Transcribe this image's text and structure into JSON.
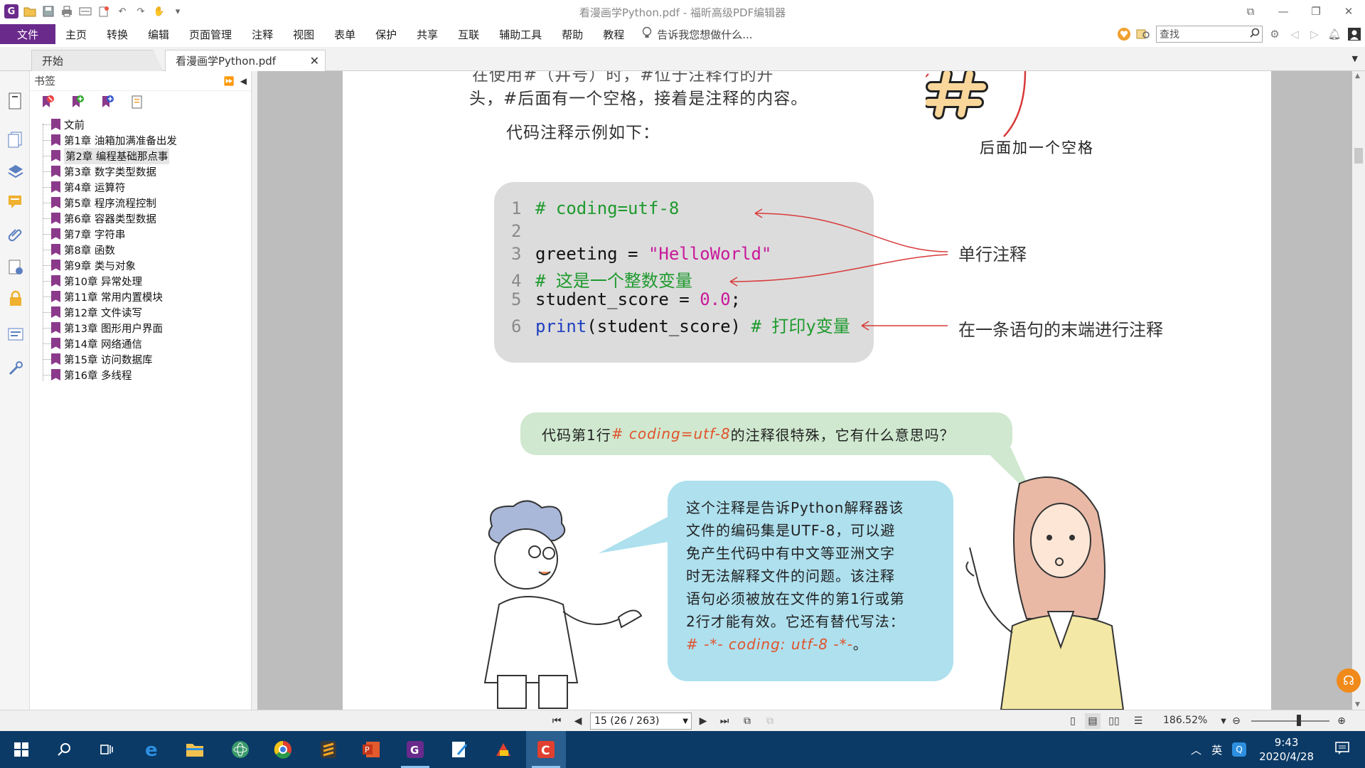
{
  "window": {
    "title": "看漫画学Python.pdf - 福昕高级PDF编辑器"
  },
  "menu": {
    "file": "文件",
    "items": [
      "主页",
      "转换",
      "编辑",
      "页面管理",
      "注释",
      "视图",
      "表单",
      "保护",
      "共享",
      "互联",
      "辅助工具",
      "帮助",
      "教程"
    ],
    "tell_me": "告诉我您想做什么...",
    "search_placeholder": "查找"
  },
  "tabs": {
    "start": "开始",
    "doc": "看漫画学Python.pdf"
  },
  "bookmarks": {
    "title": "书签",
    "items": [
      "文前",
      "第1章 油箱加满准备出发",
      "第2章 编程基础那点事",
      "第3章 数字类型数据",
      "第4章 运算符",
      "第5章 程序流程控制",
      "第6章 容器类型数据",
      "第7章 字符串",
      "第8章 函数",
      "第9章 类与对象",
      "第10章 异常处理",
      "第11章 常用内置模块",
      "第12章 文件读写",
      "第13章 图形用户界面",
      "第14章 网络通信",
      "第15章 访问数据库",
      "第16章 多线程"
    ],
    "selected_index": 2
  },
  "page": {
    "top_line": "在使用#（井号）时，#位于注释行的开",
    "line2": "头，#后面有一个空格，接着是注释的内容。",
    "example_intro": "代码注释示例如下：",
    "figure_caption": "后面加一个空格",
    "code": {
      "n1": "1",
      "c1": "# coding=utf-8",
      "n2": "2",
      "n3": "3",
      "c3a": "greeting = ",
      "c3b": "\"HelloWorld\"",
      "n4": "4",
      "c4": "# 这是一个整数变量",
      "n5": "5",
      "c5a": "student_score = ",
      "c5b": "0.0",
      "c5c": ";",
      "n6": "6",
      "c6a": "print",
      "c6b": "(student_score)  ",
      "c6c": "# 打印y变量"
    },
    "annot_single": "单行注释",
    "annot_endline": "在一条语句的末端进行注释",
    "question_pre": "代码第1行",
    "question_code": "# coding=utf-8",
    "question_post": "的注释很特殊，它有什么意思吗？",
    "answer_lines": [
      "这个注释是告诉Python解释器该",
      "文件的编码集是UTF-8，可以避",
      "免产生代码中有中文等亚洲文字",
      "时无法解释文件的问题。该注释",
      "语句必须被放在文件的第1行或第",
      "2行才能有效。它还有替代写法："
    ],
    "answer_code": "# -*- coding: utf-8 -*-",
    "answer_end": "。"
  },
  "status": {
    "page_indicator": "15 (26 / 263)",
    "zoom": "186.52%"
  },
  "taskbar": {
    "ime": "英",
    "time": "9:43",
    "date": "2020/4/28"
  },
  "colors": {
    "accent": "#6a2a8c",
    "comment_green": "#1f9a2e",
    "string_magenta": "#c8189a",
    "keyword_blue": "#1f3fbf",
    "arrow_red": "#d83a3a",
    "taskbar": "#0b3a66"
  }
}
